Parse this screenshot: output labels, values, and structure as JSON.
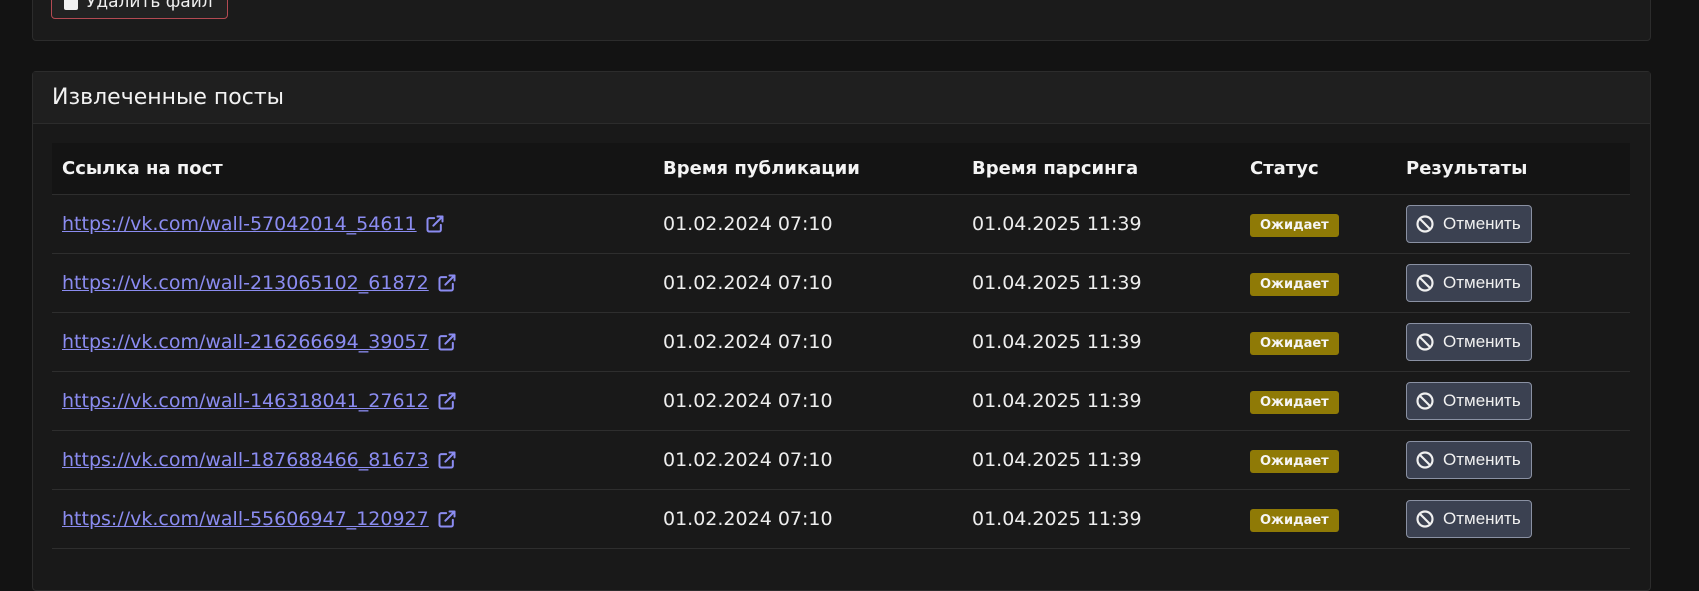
{
  "top": {
    "delete_label": "Удалить файл"
  },
  "card": {
    "title": "Извлеченные посты"
  },
  "table": {
    "headers": [
      "Ссылка на пост",
      "Время публикации",
      "Время парсинга",
      "Статус",
      "Результаты"
    ],
    "rows": [
      {
        "link": "https://vk.com/wall-57042014_54611",
        "published": "01.02.2024 07:10",
        "parsed": "01.04.2025 11:39",
        "status": "Ожидает",
        "action": "Отменить"
      },
      {
        "link": "https://vk.com/wall-213065102_61872",
        "published": "01.02.2024 07:10",
        "parsed": "01.04.2025 11:39",
        "status": "Ожидает",
        "action": "Отменить"
      },
      {
        "link": "https://vk.com/wall-216266694_39057",
        "published": "01.02.2024 07:10",
        "parsed": "01.04.2025 11:39",
        "status": "Ожидает",
        "action": "Отменить"
      },
      {
        "link": "https://vk.com/wall-146318041_27612",
        "published": "01.02.2024 07:10",
        "parsed": "01.04.2025 11:39",
        "status": "Ожидает",
        "action": "Отменить"
      },
      {
        "link": "https://vk.com/wall-187688466_81673",
        "published": "01.02.2024 07:10",
        "parsed": "01.04.2025 11:39",
        "status": "Ожидает",
        "action": "Отменить"
      },
      {
        "link": "https://vk.com/wall-55606947_120927",
        "published": "01.02.2024 07:10",
        "parsed": "01.04.2025 11:39",
        "status": "Ожидает",
        "action": "Отменить"
      }
    ]
  },
  "colors": {
    "link": "#8b8cf1",
    "status_badge": "#8f7a06",
    "cancel_button": "#3b4151"
  },
  "icons": {
    "link": "external-link-icon",
    "cancel": "ban-icon",
    "delete": "checkbox-icon"
  }
}
